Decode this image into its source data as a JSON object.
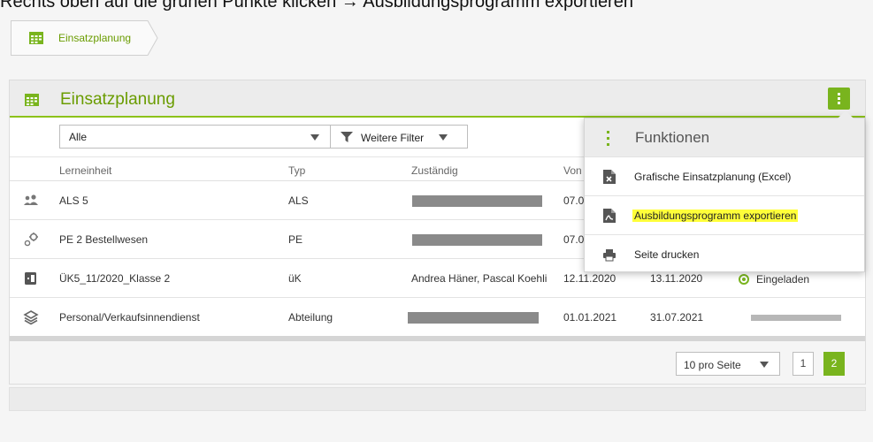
{
  "instruction": "Rechts oben auf die grünen Punkte klicken → Ausbildungsprogramm exportieren",
  "breadcrumb": {
    "label": "Einsatzplanung",
    "icon": "calendar-icon"
  },
  "card": {
    "title": "Einsatzplanung",
    "icon": "calendar-icon",
    "menu_icon": "kebab-menu-icon"
  },
  "filters": {
    "select_value": "Alle",
    "more_filter_label": "Weitere Filter"
  },
  "table": {
    "columns": [
      "Lerneinheit",
      "Typ",
      "Zuständig",
      "Von"
    ],
    "rows": [
      {
        "icon": "group-icon",
        "name": "ALS 5",
        "type": "ALS",
        "responsible": "",
        "from": "07.0",
        "to": "",
        "status": ""
      },
      {
        "icon": "gears-icon",
        "name": "PE 2 Bestellwesen",
        "type": "PE",
        "responsible": "",
        "from": "07.0",
        "to": "",
        "status": ""
      },
      {
        "icon": "door-icon",
        "name": "ÜK5_11/2020_Klasse 2",
        "type": "üK",
        "responsible": "Andrea Häner, Pascal Koehli",
        "from": "12.11.2020",
        "to": "13.11.2020",
        "status": "Eingeladen"
      },
      {
        "icon": "layers-icon",
        "name": "Personal/Verkaufsinnendienst",
        "type": "Abteilung",
        "responsible": "",
        "from": "01.01.2021",
        "to": "31.07.2021",
        "status": ""
      }
    ]
  },
  "pagination": {
    "per_page": "10 pro Seite",
    "pages": [
      "1",
      "2"
    ],
    "current": "2"
  },
  "menu": {
    "title": "Funktionen",
    "items": [
      {
        "label": "Grafische Einsatzplanung (Excel)",
        "icon": "excel-file-icon"
      },
      {
        "label": "Ausbildungsprogramm exportieren",
        "icon": "pdf-file-icon"
      },
      {
        "label": "Seite drucken",
        "icon": "printer-icon"
      }
    ]
  },
  "colors": {
    "accent": "#79b41e",
    "accent_text": "#6a9c00",
    "highlight": "#ffff3a"
  }
}
